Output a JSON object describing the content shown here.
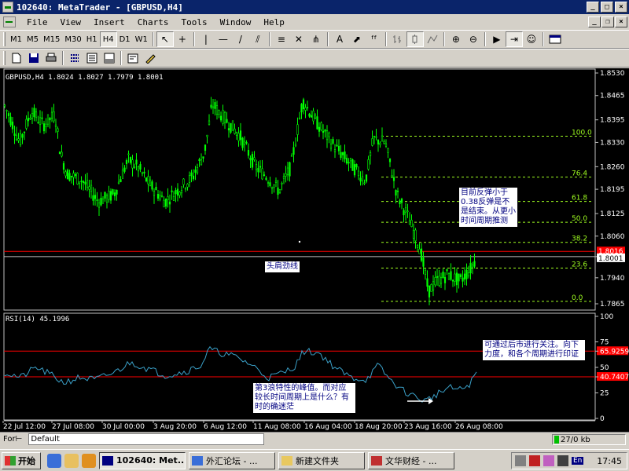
{
  "window": {
    "title": "102640: MetaTrader - [GBPUSD,H4]"
  },
  "menu": [
    "File",
    "View",
    "Insert",
    "Charts",
    "Tools",
    "Window",
    "Help"
  ],
  "timeframes": [
    "M1",
    "M5",
    "M15",
    "M30",
    "H1",
    "H4",
    "D1",
    "W1"
  ],
  "active_timeframe": "H4",
  "toolbar_glyphs": {
    "cursor": "↖",
    "crosshair": "+",
    "vline": "|",
    "hline": "—",
    "trendline": "/",
    "channel": "⫽",
    "fibo": "≡",
    "gann": "✕",
    "fan": "⋔",
    "text": "A",
    "arrow": "⬈",
    "fibo_label": "ᶠᶠ",
    "zoom_in": "⊕",
    "zoom_out": "⊖",
    "scroll": "▶",
    "autoscroll": "⇥",
    "expert": "☺"
  },
  "price_chart": {
    "header": "GBPUSD,H4  1.8024 1.8027 1.7979 1.8001",
    "price_ticks": [
      "1.8530",
      "1.8465",
      "1.8395",
      "1.8330",
      "1.8260",
      "1.8195",
      "1.8125",
      "1.8060",
      "1.8001",
      "1.7940",
      "1.7865"
    ],
    "bid_price": "1.8001",
    "red_line_price": "1.8016",
    "fib_levels": [
      {
        "label": "100.0",
        "value": 1.8348
      },
      {
        "label": "76.4",
        "value": 1.823
      },
      {
        "label": "61.8",
        "value": 1.816
      },
      {
        "label": "50.0",
        "value": 1.81
      },
      {
        "label": "38.2",
        "value": 1.8042
      },
      {
        "label": "23.6",
        "value": 1.7968
      },
      {
        "label": "0.0",
        "value": 1.7872
      }
    ],
    "neckline_label": "头肩劲线",
    "note_right": "目前反弹小于0.38反弹是不是结束。从更小时间周期推测"
  },
  "rsi_chart": {
    "header": "RSI(14)  45.1996",
    "ticks": [
      "100",
      "75",
      "65.9259",
      "50",
      "40.7407",
      "25",
      "0"
    ],
    "note_right": "可通过后市进行关注。向下力度，和各个周期进行印证",
    "note_bottom": "第3浪特性的峰值。而对应较长时间周期上是什么？有时的确迷茫"
  },
  "time_axis": [
    "22 Jul 12:00",
    "27 Jul 08:00",
    "30 Jul 00:00",
    "3 Aug 20:00",
    "6 Aug 12:00",
    "11 Aug 08:00",
    "16 Aug 04:00",
    "18 Aug 20:00",
    "23 Aug 16:00",
    "26 Aug 08:00"
  ],
  "status": {
    "tab_label": "For⊢",
    "profile": "Default",
    "traffic": "27/0 kb"
  },
  "taskbar": {
    "start": "开始",
    "tasks": [
      {
        "label": "102640: Met...",
        "active": true
      },
      {
        "label": "外汇论坛 - ...",
        "active": false
      },
      {
        "label": "新建文件夹",
        "active": false
      },
      {
        "label": "文华财经 - ...",
        "active": false
      }
    ],
    "lang": "En",
    "clock": "17:45"
  },
  "colors": {
    "candle": "#00ff00",
    "fib": "#a0ff20",
    "red_line": "#ff0000",
    "rsi_line": "#3aa0c8",
    "titlebar": "#0a246a"
  }
}
